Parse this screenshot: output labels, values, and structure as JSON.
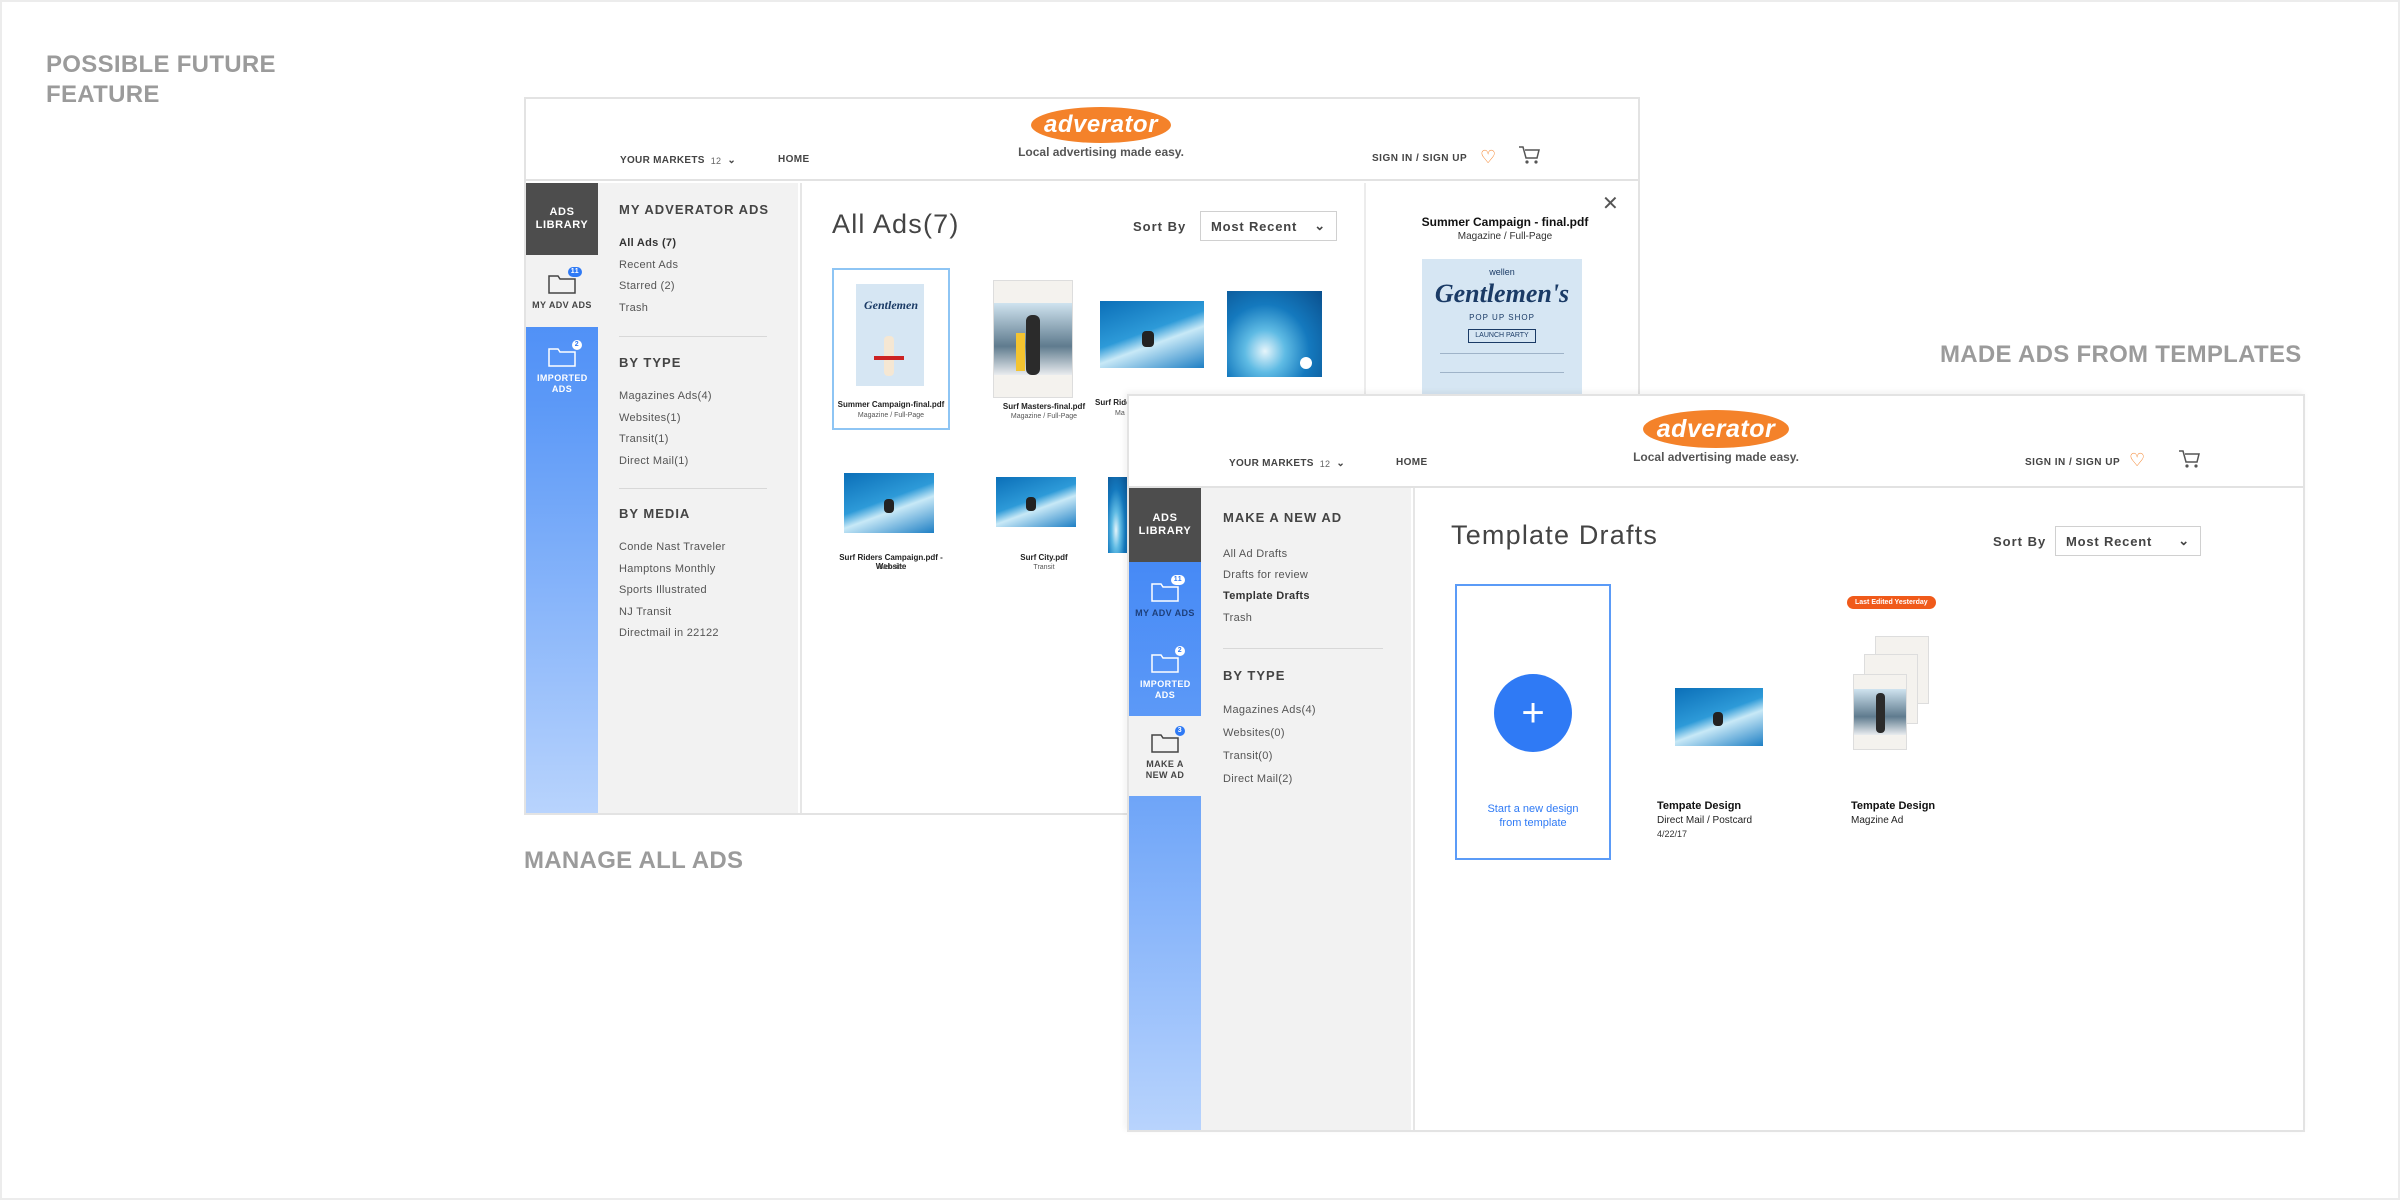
{
  "captions": {
    "future": "POSSIBLE FUTURE FEATURE",
    "manage": "MANAGE ALL ADS",
    "templates": "MADE ADS FROM TEMPLATES"
  },
  "colors": {
    "brand_orange": "#f4822a",
    "accent_blue": "#2f7af5",
    "rail_dark": "#4d4d4d",
    "badge_red": "#f05a1a"
  },
  "header": {
    "markets_label": "YOUR MARKETS",
    "markets_count": "12",
    "home_label": "HOME",
    "logo_text": "adverator",
    "tagline": "Local advertising made easy.",
    "signin_label": "SIGN IN / SIGN UP"
  },
  "rail": {
    "library_label": "ADS LIBRARY",
    "my_adv_label": "MY ADV ADS",
    "my_adv_badge": "11",
    "imported_label": "IMPORTED ADS",
    "imported_badge": "2",
    "make_new_label": "MAKE A NEW AD",
    "make_new_badge": "3"
  },
  "manage_window": {
    "subnav": {
      "section_title": "MY ADVERATOR ADS",
      "items": [
        "All Ads (7)",
        "Recent Ads",
        "Starred (2)",
        "Trash"
      ],
      "by_type_title": "BY TYPE",
      "type_items": [
        "Magazines Ads(4)",
        "Websites(1)",
        "Transit(1)",
        "Direct Mail(1)"
      ],
      "by_media_title": "BY MEDIA",
      "media_items": [
        "Conde Nast Traveler",
        "Hamptons Monthly",
        "Sports Illustrated",
        "NJ Transit",
        "Directmail in 22122"
      ]
    },
    "title": "All Ads(7)",
    "sort_label": "Sort By",
    "sort_value": "Most Recent",
    "ads": [
      {
        "name": "Summer Campaign-final.pdf",
        "type": "Magazine / Full-Page"
      },
      {
        "name": "Surf Masters-final.pdf",
        "type": "Magazine / Full-Page"
      },
      {
        "name": "Surf Riders",
        "type": "Ma"
      },
      {
        "name": "",
        "type": ""
      },
      {
        "name": "Surf Riders Campaign.pdf - Website",
        "type": "Website"
      },
      {
        "name": "Surf City.pdf",
        "type": "Transit"
      }
    ],
    "detail": {
      "title": "Summer Campaign - final.pdf",
      "subtitle": "Magazine / Full-Page",
      "poster_brand": "wellen",
      "poster_title": "Gentlemen's",
      "poster_sub": "POP UP SHOP",
      "poster_cta": "LAUNCH PARTY"
    }
  },
  "templates_window": {
    "subnav": {
      "section_title": "MAKE A NEW AD",
      "items": [
        "All Ad Drafts",
        "Drafts for review",
        "Template Drafts",
        "Trash"
      ],
      "by_type_title": "BY TYPE",
      "type_items": [
        "Magazines Ads(4)",
        "Websites(0)",
        "Transit(0)",
        "Direct Mail(2)"
      ]
    },
    "title": "Template Drafts",
    "sort_label": "Sort By",
    "sort_value": "Most Recent",
    "new_design_text": "Start a new design from template",
    "templates": [
      {
        "name": "Tempate Design",
        "type": "Direct Mail / Postcard",
        "date": "4/22/17"
      },
      {
        "name": "Tempate Design",
        "type": "Magzine Ad",
        "badge": "Last Edited Yesterday"
      }
    ]
  }
}
